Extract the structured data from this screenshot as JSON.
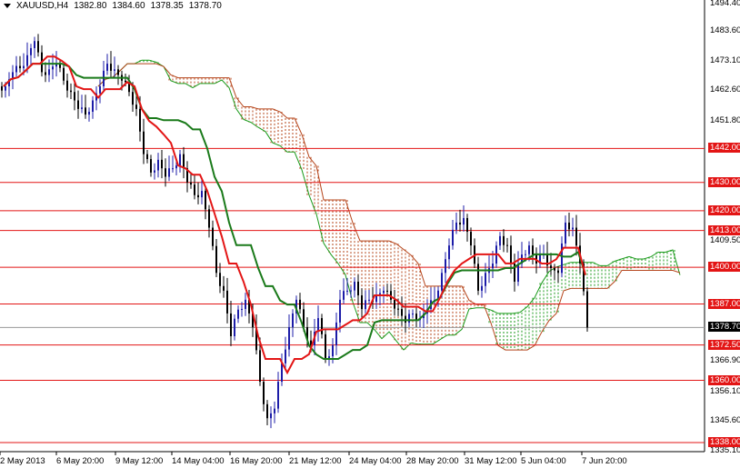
{
  "header": {
    "symbol": "XAUUSD,H4",
    "open": "1382.80",
    "high": "1384.60",
    "low": "1378.35",
    "close": "1378.70"
  },
  "chart_data": {
    "type": "candlestick",
    "title": "XAUUSD,H4",
    "ylim": [
      1335.1,
      1494.4
    ],
    "price_ticks": [
      "1494.40",
      "1483.60",
      "1473.10",
      "1462.60",
      "1451.80",
      "1409.50",
      "1366.90",
      "1356.10",
      "1345.60",
      "1335.10"
    ],
    "levels": [
      {
        "label": "1442.00",
        "value": 1442
      },
      {
        "label": "1430.00",
        "value": 1430
      },
      {
        "label": "1420.00",
        "value": 1420
      },
      {
        "label": "1413.00",
        "value": 1413
      },
      {
        "label": "1400.00",
        "value": 1400
      },
      {
        "label": "1387.00",
        "value": 1387
      },
      {
        "label": "1372.50",
        "value": 1372.5
      },
      {
        "label": "1360.00",
        "value": 1360
      },
      {
        "label": "1338.00",
        "value": 1338
      }
    ],
    "current_price": {
      "label": "1378.70",
      "value": 1378.7
    },
    "time_labels": [
      "2 May 2013",
      "6 May 20:00",
      "9 May 12:00",
      "14 May 04:00",
      "16 May 20:00",
      "21 May 12:00",
      "24 May 04:00",
      "28 May 20:00",
      "31 May 12:00",
      "5 Jun 04:00",
      "7 Jun 20:00"
    ],
    "closes": [
      1464,
      1469,
      1470.4,
      1475,
      1480,
      1469,
      1470,
      1472,
      1466,
      1462,
      1456,
      1454,
      1459,
      1464,
      1472,
      1470,
      1466,
      1462,
      1456,
      1440,
      1433.5,
      1438,
      1432,
      1435,
      1440,
      1430,
      1425.5,
      1427,
      1414,
      1398,
      1391.7,
      1375.6,
      1385,
      1388.5,
      1378.8,
      1359.5,
      1346.6,
      1350,
      1366,
      1378.8,
      1388.5,
      1378.8,
      1372.4,
      1382,
      1367.6,
      1372.4,
      1388.5,
      1391.7,
      1394.9,
      1385.2,
      1388.5,
      1390,
      1391.7,
      1388.5,
      1385.2,
      1380.4,
      1383.6,
      1382,
      1385.2,
      1388.5,
      1398,
      1407.7,
      1415.8,
      1417.4,
      1407.7,
      1391.7,
      1398,
      1401.3,
      1411,
      1407.7,
      1394.9,
      1404.5,
      1407.7,
      1401.3,
      1404.5,
      1399.7,
      1398,
      1415.8,
      1414,
      1401.3,
      1378.7
    ],
    "series": [
      {
        "name": "Tenkan-sen",
        "color": "#e31515"
      },
      {
        "name": "Kijun-sen",
        "color": "#1a7a1a"
      },
      {
        "name": "Senkou Span A",
        "color": "#1a9a1a"
      },
      {
        "name": "Senkou Span B",
        "color": "#b5441a"
      }
    ]
  }
}
